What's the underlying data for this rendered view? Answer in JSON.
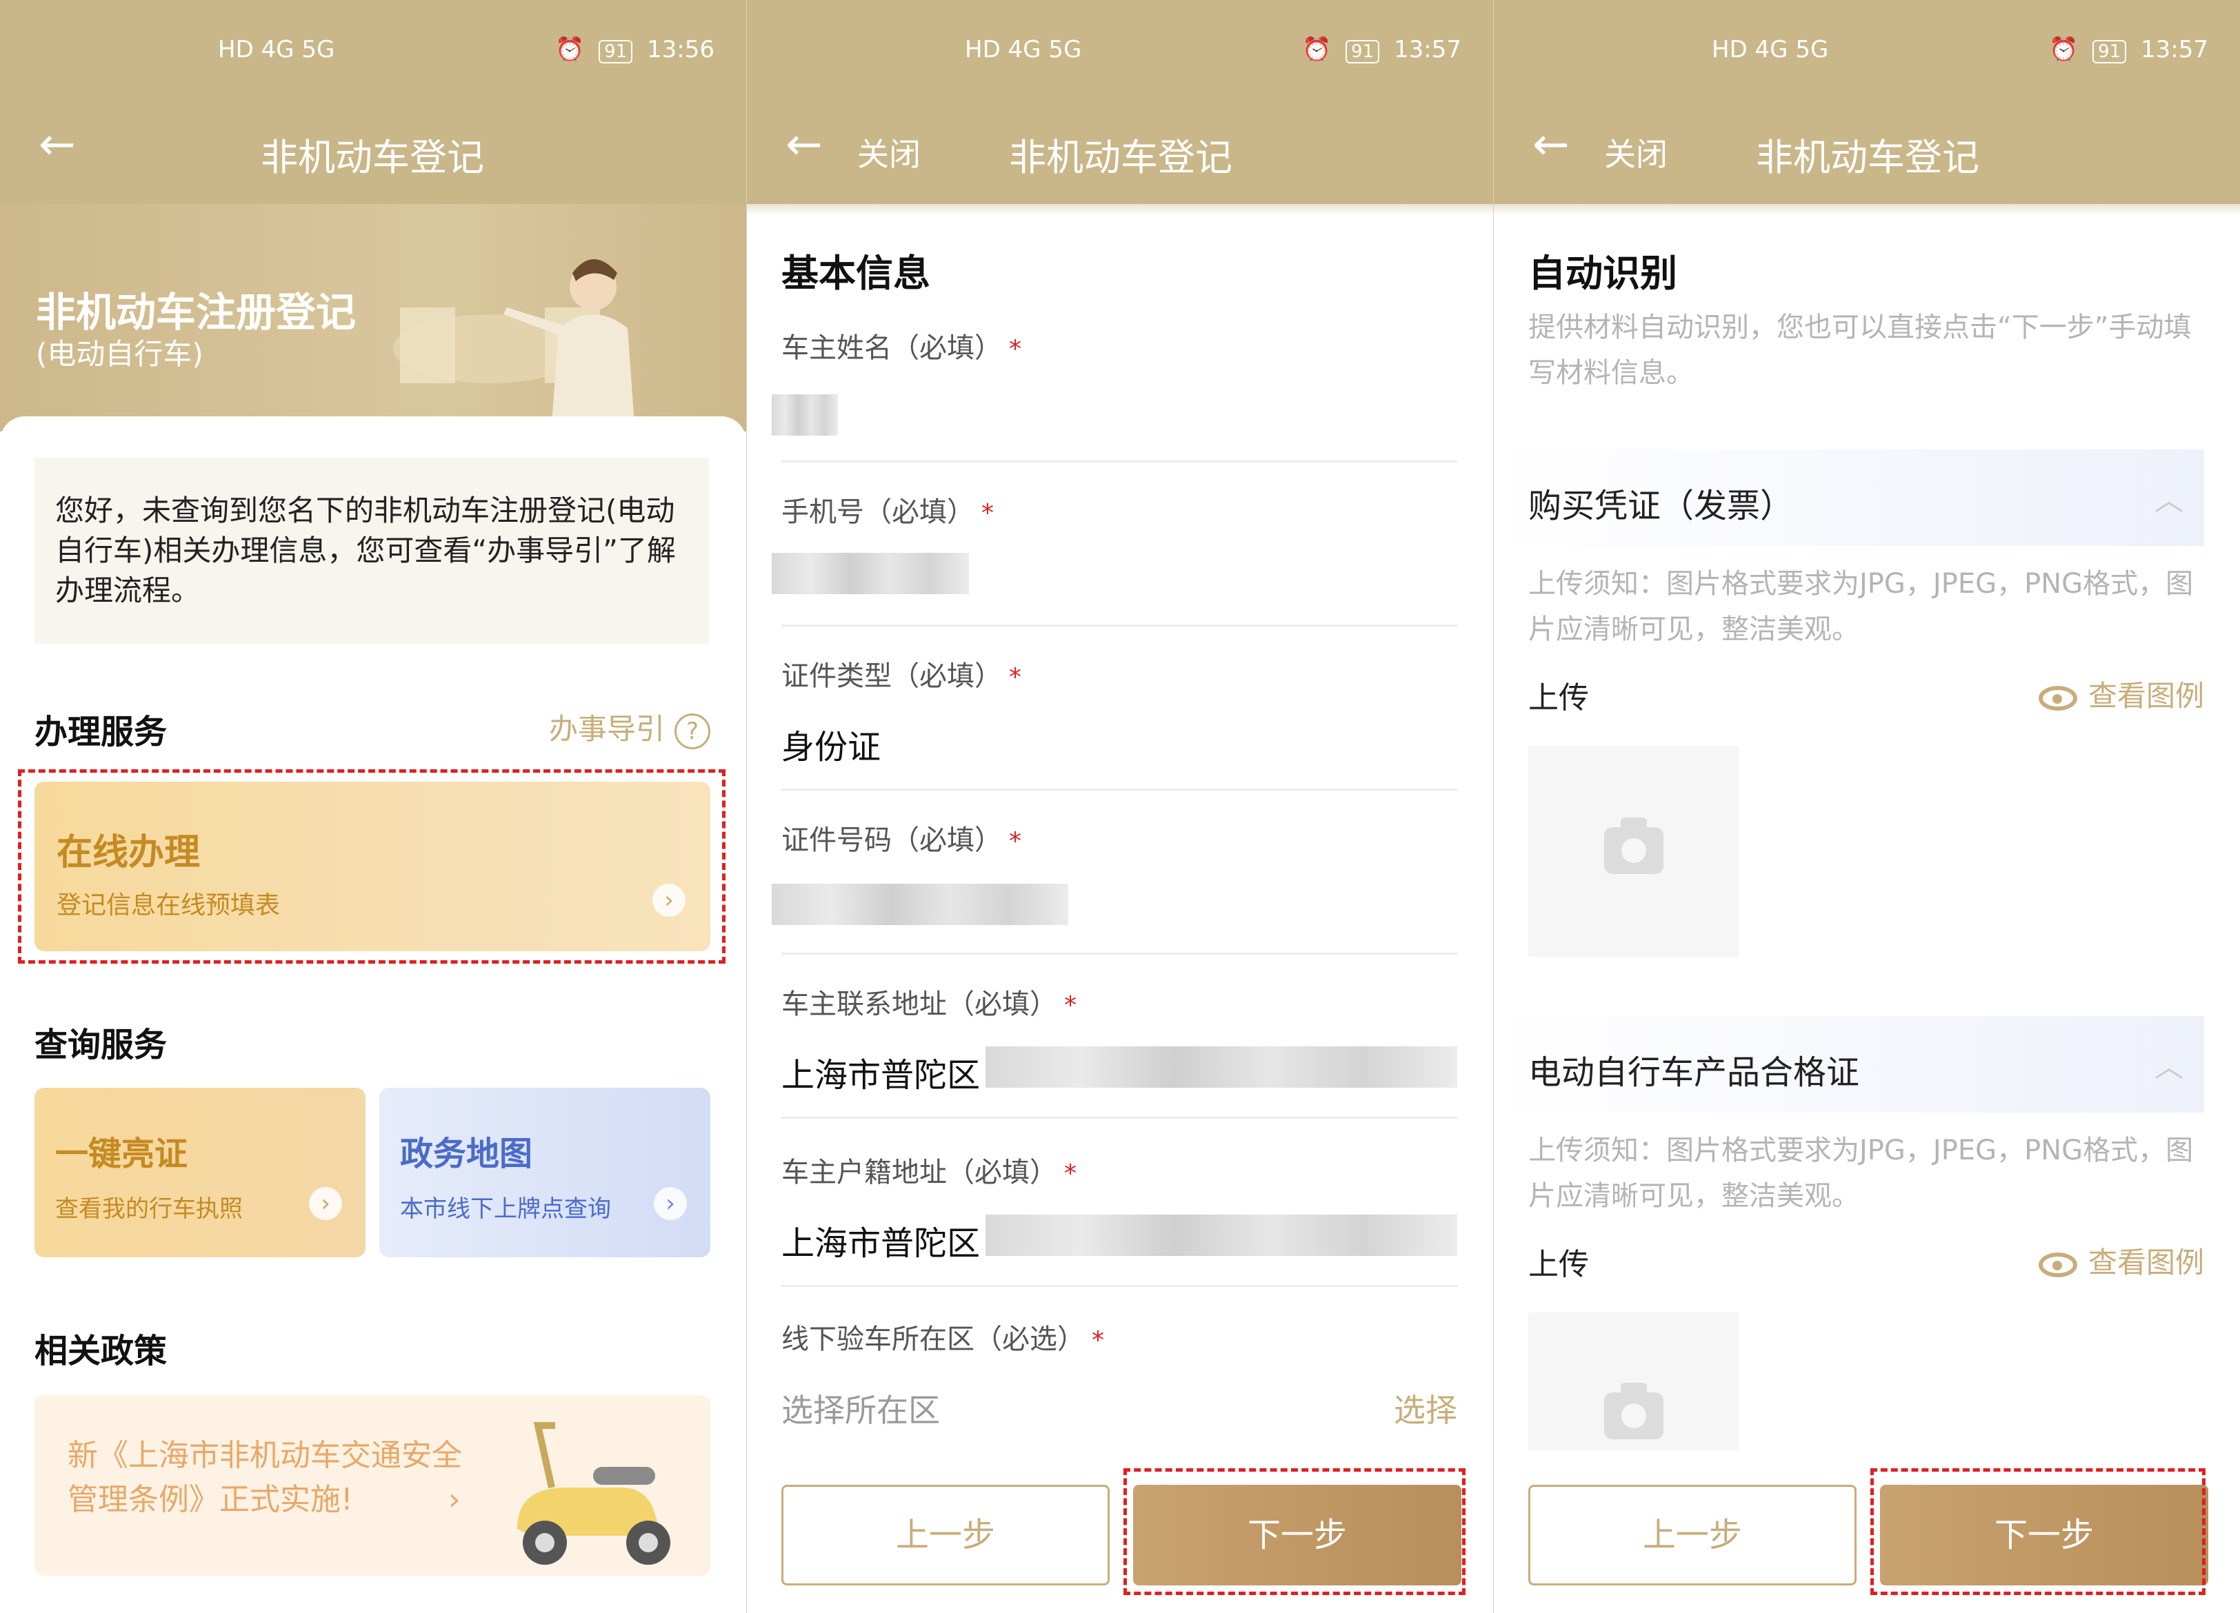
{
  "status": {
    "left": "HD 4G 5G",
    "battery": "91",
    "time1": "13:56",
    "time2": "13:57",
    "time3": "13:57"
  },
  "header": {
    "title": "非机动车登记",
    "close": "关闭",
    "back_icon": "arrow-left-icon"
  },
  "panel1": {
    "banner_title": "非机动车注册登记",
    "banner_sub": "(电动自行车)",
    "notice": "您好，未查询到您名下的非机动车注册登记(电动自行车)相关办理信息，您可查看“办事导引”了解办理流程。",
    "service_title": "办理服务",
    "guide_label": "办事导引",
    "online_title": "在线办理",
    "online_sub": "登记信息在线预填表",
    "query_title": "查询服务",
    "tile1_title": "一键亮证",
    "tile1_sub": "查看我的行车执照",
    "tile2_title": "政务地图",
    "tile2_sub": "本市线下上牌点查询",
    "policy_title": "相关政策",
    "policy_text": "新《上海市非机动车交通安全管理条例》正式实施!"
  },
  "panel2": {
    "section_title": "基本信息",
    "required_mark": "*",
    "fields": [
      {
        "label": "车主姓名（必填）",
        "value": ""
      },
      {
        "label": "手机号（必填）",
        "value": ""
      },
      {
        "label": "证件类型（必填）",
        "value": "身份证"
      },
      {
        "label": "证件号码（必填）",
        "value": ""
      },
      {
        "label": "车主联系地址（必填）",
        "value": "上海市普陀区"
      },
      {
        "label": "车主户籍地址（必填）",
        "value": "上海市普陀区"
      }
    ],
    "district_label": "线下验车所在区（必选）",
    "district_placeholder": "选择所在区",
    "select_link": "选择",
    "prev": "上一步",
    "next": "下一步"
  },
  "panel3": {
    "section_title": "自动识别",
    "desc": "提供材料自动识别，您也可以直接点击“下一步”手动填写材料信息。",
    "invoice_title": "购买凭证（发票）",
    "certificate_title": "电动自行车产品合格证",
    "upload_note": "上传须知：图片格式要求为JPG，JPEG，PNG格式，图片应清晰可见，整洁美观。",
    "upload_label": "上传",
    "view_example": "查看图例",
    "prev": "上一步",
    "next": "下一步"
  },
  "colors": {
    "header_bg": "#c9b78a",
    "accent": "#c8ad7a",
    "highlight": "#e02020",
    "button_next": "#b88f5c"
  }
}
